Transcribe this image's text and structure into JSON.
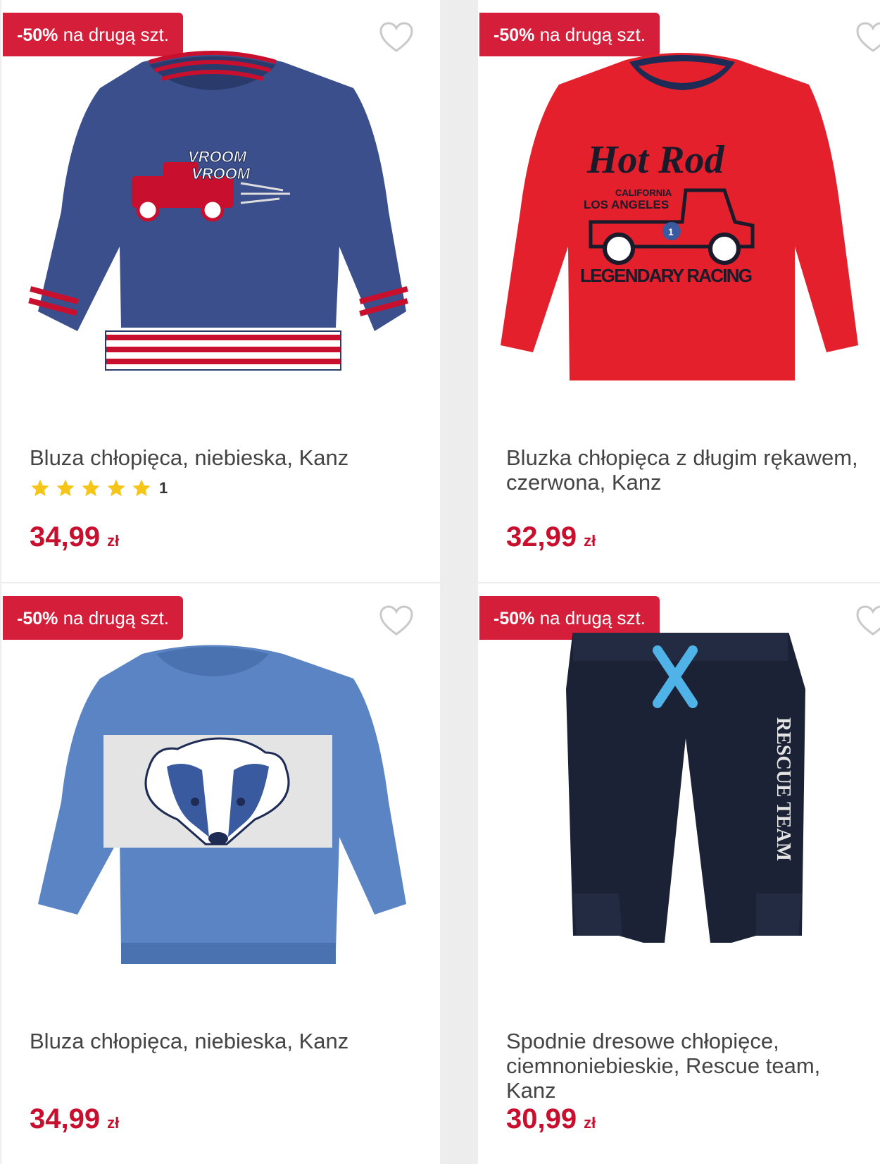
{
  "products": [
    {
      "badge_pct": "-50%",
      "badge_text": " na drugą szt.",
      "title": "Bluza chłopięca, niebieska, Kanz",
      "rating_count": "1",
      "stars": 5,
      "price": "34,99",
      "currency": "zł",
      "image_graphic_text": [
        "VROOM",
        "VROOM"
      ]
    },
    {
      "badge_pct": "-50%",
      "badge_text": " na drugą szt.",
      "title": "Bluzka chłopięca z długim rękawem, czerwona, Kanz",
      "price": "32,99",
      "currency": "zł",
      "image_graphic_text": [
        "Hot Rod",
        "CALIFORNIA",
        "LOS ANGELES",
        "1",
        "LEGENDARY RACING"
      ]
    },
    {
      "badge_pct": "-50%",
      "badge_text": " na drugą szt.",
      "title": "Bluza chłopięca, niebieska, Kanz",
      "price": "34,99",
      "currency": "zł"
    },
    {
      "badge_pct": "-50%",
      "badge_text": " na drugą szt.",
      "title": "Spodnie dresowe chłopięce, ciemnoniebieskie, Rescue team, Kanz",
      "price": "30,99",
      "currency": "zł",
      "image_graphic_text": [
        "RESCUE TEAM"
      ]
    }
  ],
  "colors": {
    "badge": "#d41e3a",
    "price": "#c8102e",
    "star": "#f5c518"
  },
  "icons": {
    "wishlist": "heart-outline-icon",
    "rating": "star-icon"
  }
}
